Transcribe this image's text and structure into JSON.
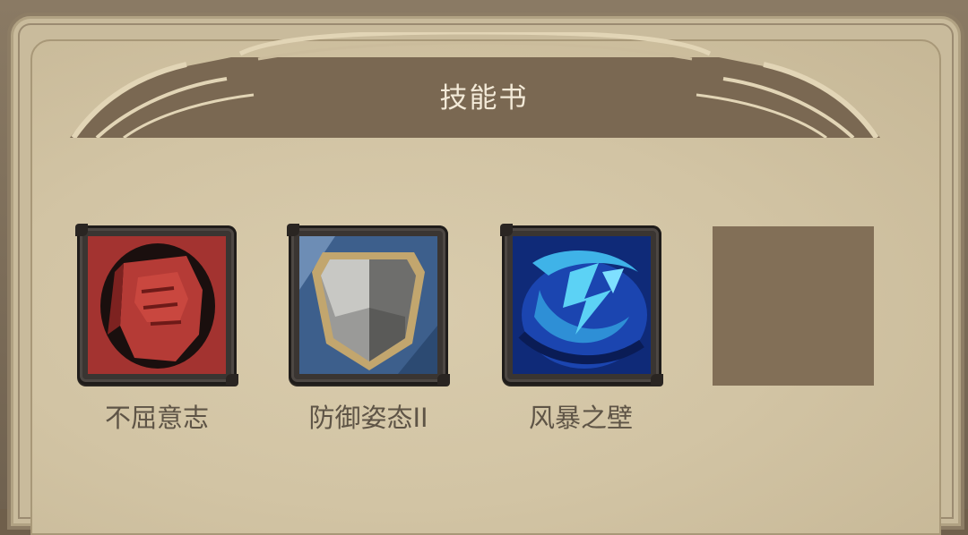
{
  "window": {
    "title": "技能书"
  },
  "skills": [
    {
      "name": "不屈意志",
      "icon": "red-fist-icon"
    },
    {
      "name": "防御姿态II",
      "icon": "shield-icon"
    },
    {
      "name": "风暴之壁",
      "icon": "blue-storm-icon"
    }
  ],
  "empty_slot": {
    "icon": "empty-slot"
  },
  "colors": {
    "panel": "#c9bb9c",
    "banner": "#7a6852",
    "label": "#5e5446",
    "title": "#f3ead8"
  }
}
